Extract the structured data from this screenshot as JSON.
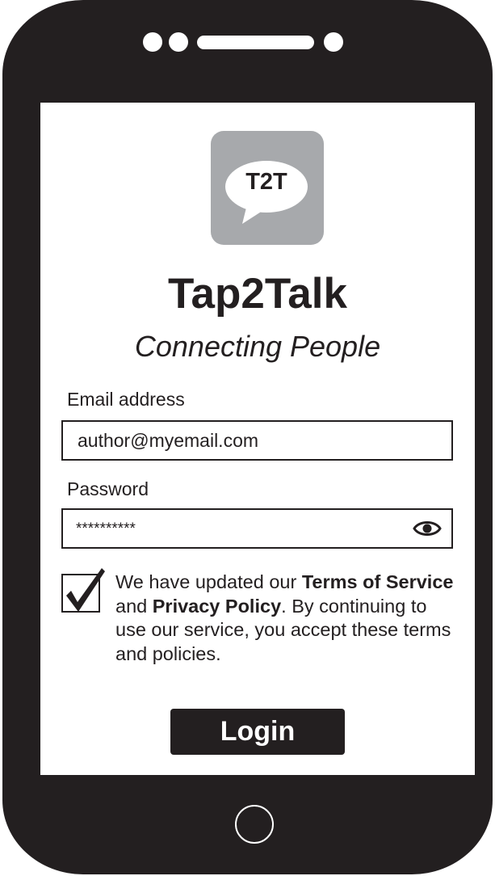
{
  "logo": {
    "text": "T2T"
  },
  "app": {
    "name": "Tap2Talk",
    "tagline": "Connecting People"
  },
  "form": {
    "email_label": "Email address",
    "email_value": "author@myemail.com",
    "password_label": "Password",
    "password_value": "**********",
    "show_password_icon": "eye-icon"
  },
  "consent": {
    "checked": true,
    "text_1": "We have updated our ",
    "terms_link": "Terms of Service",
    "text_2": " and ",
    "privacy_link": "Privacy Policy",
    "text_3": ". By continuing to use our service, you accept these terms and policies."
  },
  "actions": {
    "login_label": "Login"
  },
  "colors": {
    "device": "#231f20",
    "logo_tile": "#a7a9ac",
    "screen": "#ffffff"
  }
}
